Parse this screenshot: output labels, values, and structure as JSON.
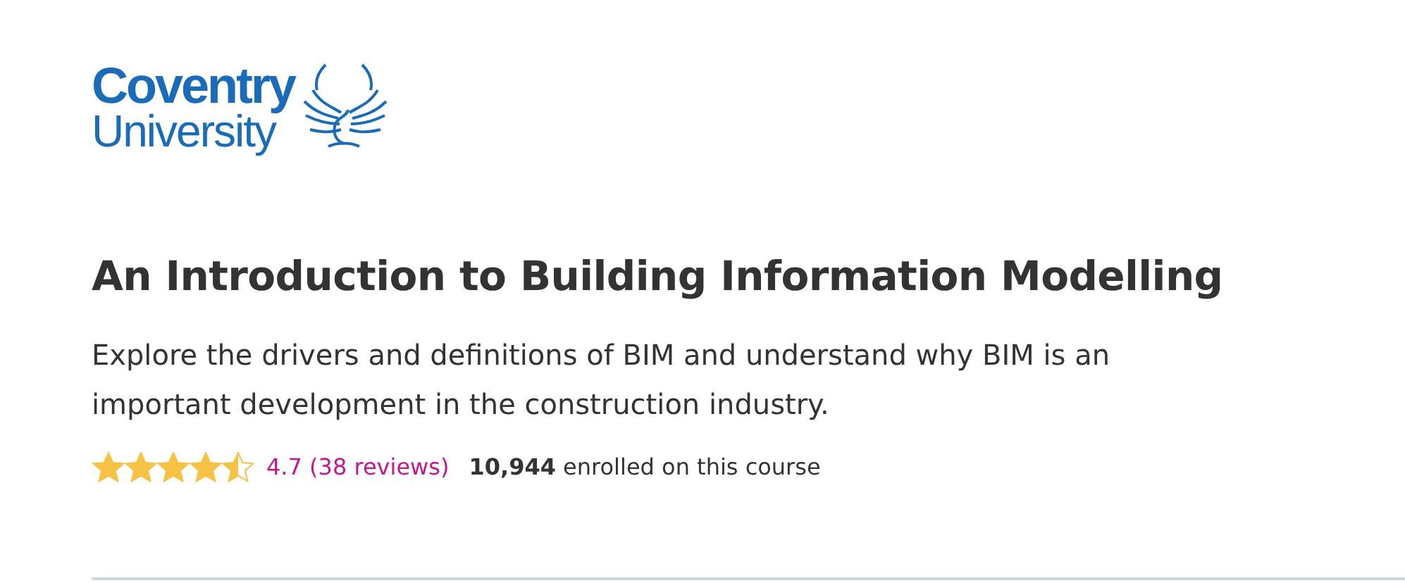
{
  "logo": {
    "line_1": "Coventry",
    "line_2": "University"
  },
  "title": "An Introduction to Building Information Modelling",
  "description": "Explore the drivers and definitions of BIM and understand why BIM is an important development in the construction industry.",
  "rating": {
    "stars": 4.5,
    "score": "4.7 (38 reviews)",
    "enrolled": "**10,944** enrolled on this course"
  }
}
